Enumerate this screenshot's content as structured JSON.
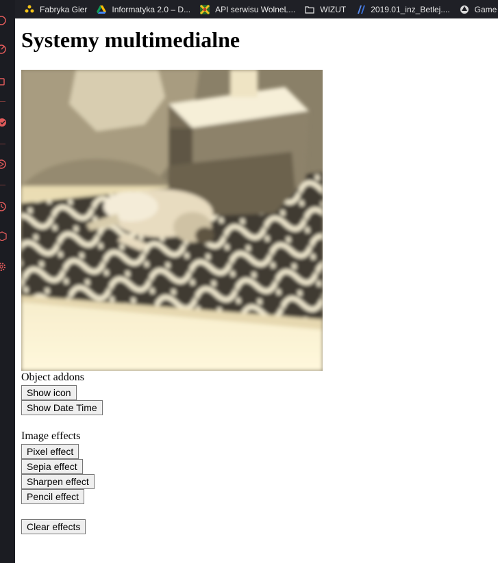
{
  "bookmarks": [
    {
      "label": "Fabryka Gier",
      "icon": "fabryka-gier-icon"
    },
    {
      "label": "Informatyka 2.0 – D...",
      "icon": "google-drive-icon"
    },
    {
      "label": "API serwisu WolneL...",
      "icon": "wolne-lektury-icon"
    },
    {
      "label": "WIZUT",
      "icon": "folder-icon"
    },
    {
      "label": "2019.01_inz_Betlej....",
      "icon": "jira-icon"
    },
    {
      "label": "Game Ma",
      "icon": "unity-icon"
    }
  ],
  "page": {
    "title": "Systemy multimedialne"
  },
  "addons": {
    "label": "Object addons",
    "show_icon": "Show icon",
    "show_date_time": "Show Date Time"
  },
  "effects": {
    "label": "Image effects",
    "pixel": "Pixel effect",
    "sepia": "Sepia effect",
    "sharpen": "Sharpen effect",
    "pencil": "Pencil effect",
    "clear": "Clear effects"
  },
  "colors": {
    "sidebar_bg": "#1b1c22",
    "sidebar_icon": "#e05a5a",
    "sepia_light": "#fbf4d8",
    "sepia_dark": "#3e3a32"
  }
}
